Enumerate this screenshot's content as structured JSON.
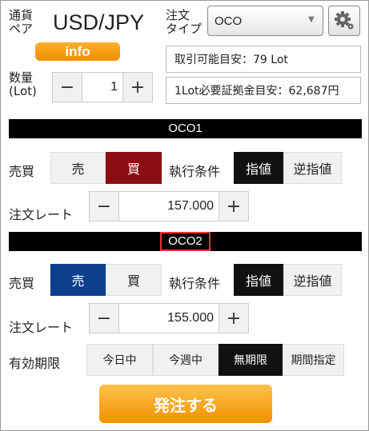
{
  "header": {
    "pair_label": "通貨\nペア",
    "pair": "USD/JPY",
    "order_type_label": "注文\nタイプ",
    "order_type": "OCO",
    "info_label": "info",
    "tradable": "取引可能目安：79 Lot",
    "margin": "1Lot必要証拠金目安：62,687円"
  },
  "qty": {
    "label": "数量\n(Lot)",
    "value": "1",
    "minus": "−",
    "plus": "+"
  },
  "oco1": {
    "title": "OCO1",
    "side_label": "売買",
    "sell": "売",
    "buy": "買",
    "exec_label": "執行条件",
    "limit": "指値",
    "stop": "逆指値",
    "rate_label": "注文レート",
    "rate": "157.000",
    "minus": "−",
    "plus": "+"
  },
  "oco2": {
    "title": "OCO2",
    "side_label": "売買",
    "sell": "売",
    "buy": "買",
    "exec_label": "執行条件",
    "limit": "指値",
    "stop": "逆指値",
    "rate_label": "注文レート",
    "rate": "155.000",
    "minus": "−",
    "plus": "+"
  },
  "expiry": {
    "label": "有効期限",
    "options": [
      "今日中",
      "今週中",
      "無期限",
      "期間指定"
    ]
  },
  "submit_label": "発注する",
  "colors": {
    "accent": "#f39a12",
    "buy_selected": "#8b0f12",
    "sell_selected": "#0d3f8f",
    "highlight": "#e33333"
  }
}
